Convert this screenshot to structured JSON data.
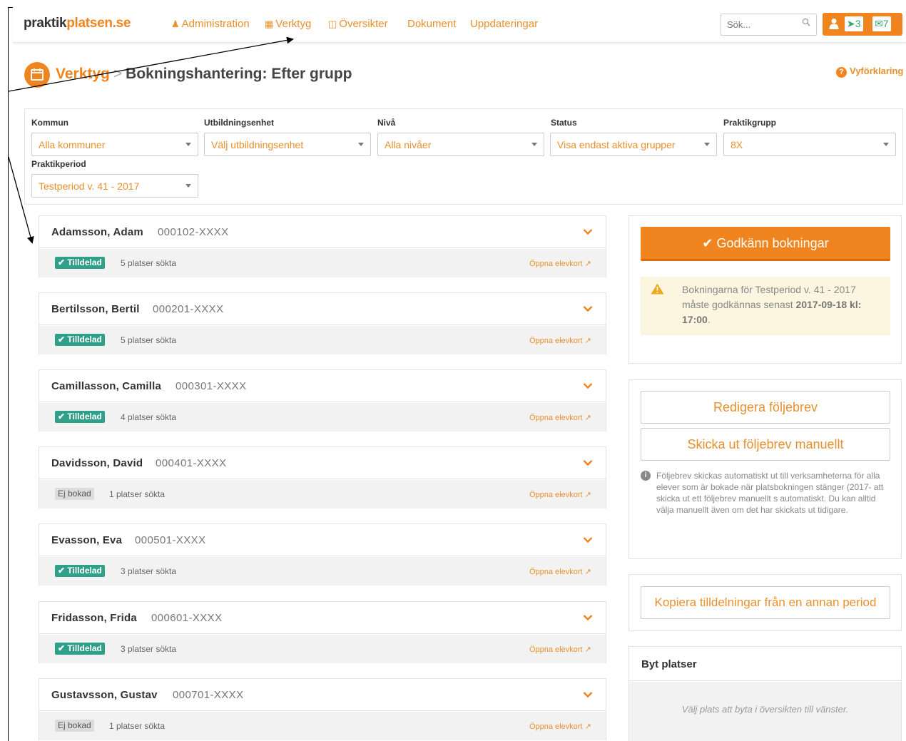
{
  "navbar": {
    "brand_part1": "praktik",
    "brand_part2": "platsen.se",
    "items": [
      {
        "label": "Administration",
        "icon": "user-icon"
      },
      {
        "label": "Verktyg",
        "icon": "calendar-icon"
      },
      {
        "label": "Översikter",
        "icon": "bar-chart-icon"
      },
      {
        "label": "Dokument"
      },
      {
        "label": "Uppdateringar"
      }
    ],
    "search_placeholder": "Sök...",
    "pin_count": "3",
    "mail_count": "7"
  },
  "header": {
    "breadcrumb": "Verktyg",
    "separator": ">",
    "title": "Bokningshantering: Efter grupp",
    "help_link": "Vyförklaring"
  },
  "filters": {
    "kommun_label": "Kommun",
    "kommun_value": "Alla kommuner",
    "enhet_label": "Utbildningsenhet",
    "enhet_value": "Välj utbildningsenhet",
    "niva_label": "Nivå",
    "niva_value": "Alla nivåer",
    "status_label": "Status",
    "status_value": "Visa endast aktiva grupper",
    "grupp_label": "Praktikgrupp",
    "grupp_value": "8X",
    "period_label": "Praktikperiod",
    "period_value": "Testperiod v. 41 - 2017"
  },
  "students": [
    {
      "name": "Adamsson, Adam",
      "pnr": "000102-XXXX",
      "badge": "Tilldelad",
      "places": "5 platser sökta",
      "link": "Öppna elevkort"
    },
    {
      "name": "Bertilsson, Bertil",
      "pnr": "000201-XXXX",
      "badge": "Tilldelad",
      "places": "5 platser sökta",
      "link": "Öppna elevkort"
    },
    {
      "name": "Camillasson, Camilla",
      "pnr": "000301-XXXX",
      "badge": "Tilldelad",
      "places": "4 platser sökta",
      "link": "Öppna elevkort"
    },
    {
      "name": "Davidsson, David",
      "pnr": "000401-XXXX",
      "badge": "Ej bokad",
      "places": "1 platser sökta",
      "link": "Öppna elevkort"
    },
    {
      "name": "Evasson, Eva",
      "pnr": "000501-XXXX",
      "badge": "Tilldelad",
      "places": "3 platser sökta",
      "link": "Öppna elevkort"
    },
    {
      "name": "Fridasson, Frida",
      "pnr": "000601-XXXX",
      "badge": "Tilldelad",
      "places": "3 platser sökta",
      "link": "Öppna elevkort"
    },
    {
      "name": "Gustavsson, Gustav",
      "pnr": "000701-XXXX",
      "badge": "Ej bokad",
      "places": "1 platser sökta",
      "link": "Öppna elevkort"
    }
  ],
  "sidebar": {
    "approve_button": "Godkänn bokningar",
    "warning_pre": "Bokningarna för Testperiod v. 41 - 2017 måste godkännas senast ",
    "warning_bold": "2017-09-18 kl: 17:00",
    "warning_post": ".",
    "edit_letter_button": "Redigera följebrev",
    "send_letter_button": "Skicka ut följebrev manuellt",
    "info_text": "Följebrev skickas automatiskt ut till verksamheterna för alla elever som är bokade när platsbokningen stänger (2017- att skicka ut ett följebrev manuellt s automatiskt. Du kan alltid välja manuellt även om det har skickats ut tidigare.",
    "copy_button": "Kopiera tilldelningar från en annan period",
    "swap_title": "Byt platser",
    "swap_hint": "Välj plats att byta i översikten till vänster."
  },
  "colors": {
    "accent": "#f0841e",
    "badge_green": "#2fa18a",
    "badge_grey": "#dcdcdc",
    "warning_bg": "#fcf5df"
  }
}
